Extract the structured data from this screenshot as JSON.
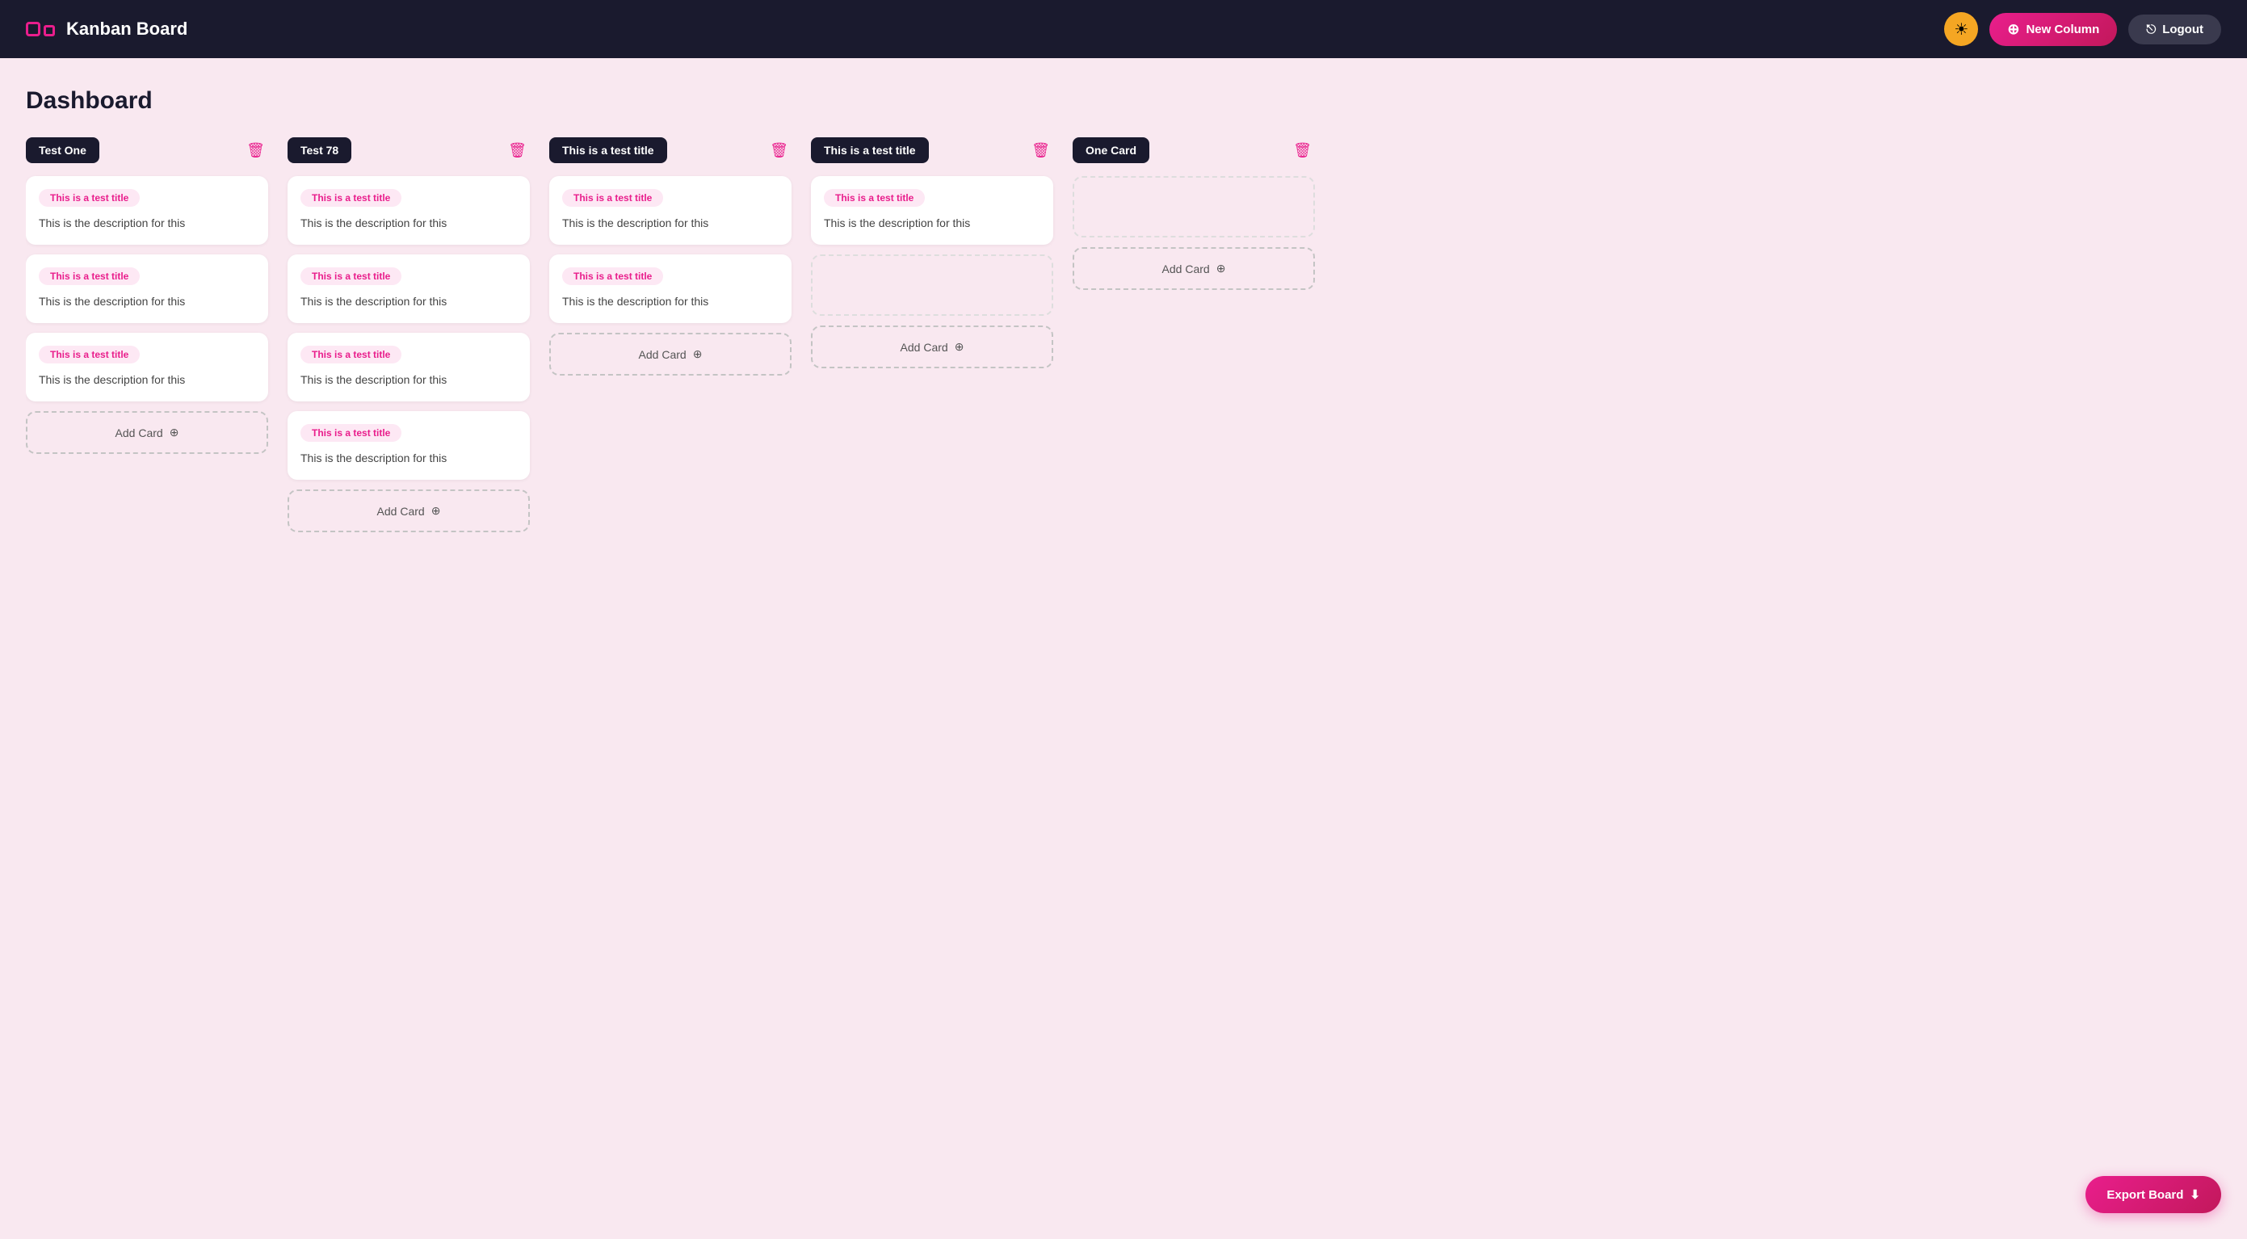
{
  "header": {
    "app_name": "Kanban Board",
    "theme_icon": "☀",
    "new_column_label": "New Column",
    "logout_label": "Logout"
  },
  "main": {
    "title": "Dashboard",
    "columns": [
      {
        "id": "col1",
        "title": "Test One",
        "cards": [
          {
            "tag": "This is a test title",
            "desc": "This is the description for this"
          },
          {
            "tag": "This is a test title",
            "desc": "This is the description for this"
          },
          {
            "tag": "This is a test title",
            "desc": "This is the description for this"
          }
        ],
        "add_card_label": "Add Card"
      },
      {
        "id": "col2",
        "title": "Test 78",
        "cards": [
          {
            "tag": "This is a test title",
            "desc": "This is the description for this"
          },
          {
            "tag": "This is a test title",
            "desc": "This is the description for this"
          },
          {
            "tag": "This is a test title",
            "desc": "This is the description for this"
          },
          {
            "tag": "This is a test title",
            "desc": "This is the description for this"
          }
        ],
        "add_card_label": "Add Card"
      },
      {
        "id": "col3",
        "title": "This is a test title",
        "cards": [
          {
            "tag": "This is a test title",
            "desc": "This is the description for this"
          },
          {
            "tag": "This is a test title",
            "desc": "This is the description for this"
          }
        ],
        "add_card_label": "Add Card"
      },
      {
        "id": "col4",
        "title": "This is a test title",
        "cards": [
          {
            "tag": "This is a test title",
            "desc": "This is the description for this"
          }
        ],
        "add_card_label": "Add Card",
        "has_empty_placeholder": true
      },
      {
        "id": "col5",
        "title": "One Card",
        "cards": [],
        "add_card_label": "Add Card",
        "has_empty_placeholder": true
      }
    ],
    "export_label": "Export Board"
  }
}
